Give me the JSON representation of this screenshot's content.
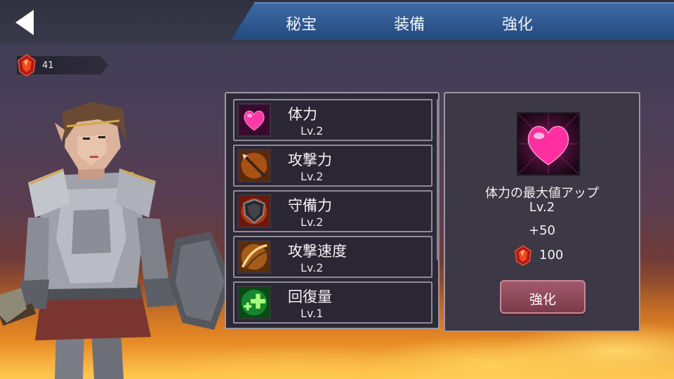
{
  "header": {
    "tabs": [
      {
        "label": "秘宝"
      },
      {
        "label": "装備"
      },
      {
        "label": "強化"
      }
    ]
  },
  "currency": {
    "gems": "41",
    "icon": "red-gem-icon"
  },
  "skills": [
    {
      "name": "体力",
      "level": "Lv.2",
      "icon": "heart-icon"
    },
    {
      "name": "攻撃力",
      "level": "Lv.2",
      "icon": "spear-icon"
    },
    {
      "name": "守備力",
      "level": "Lv.2",
      "icon": "shield-icon"
    },
    {
      "name": "攻撃速度",
      "level": "Lv.2",
      "icon": "speed-slash-icon"
    },
    {
      "name": "回復量",
      "level": "Lv.1",
      "icon": "green-cross-icon"
    }
  ],
  "detail": {
    "icon": "heart-icon",
    "title": "体力の最大値アップ",
    "level": "Lv.2",
    "bonus": "+50",
    "cost": "100",
    "button_label": "強化"
  },
  "colors": {
    "tab_blue": "#2f5a91",
    "panel_bg": "#2d2a36",
    "button_rose": "#8e4a5c"
  }
}
